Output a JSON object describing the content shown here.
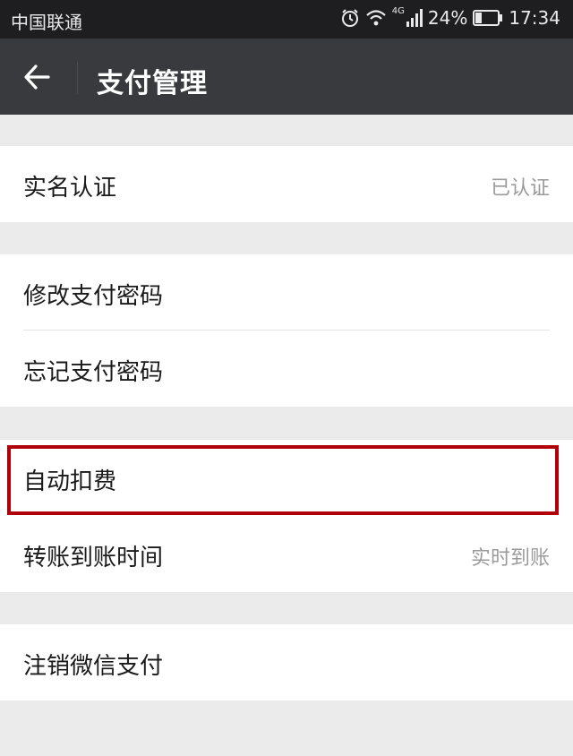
{
  "status_bar": {
    "carrier": "中国联通",
    "network": "4G",
    "battery": "24%",
    "time": "17:34",
    "icons": [
      "alarm-icon",
      "wifi-icon",
      "signal-icon",
      "battery-icon"
    ]
  },
  "header": {
    "title": "支付管理",
    "back_icon": "back-arrow-icon"
  },
  "groups": [
    {
      "rows": [
        {
          "label": "实名认证",
          "value": "已认证"
        }
      ]
    },
    {
      "rows": [
        {
          "label": "修改支付密码",
          "value": ""
        },
        {
          "label": "忘记支付密码",
          "value": ""
        }
      ]
    },
    {
      "rows": [
        {
          "label": "自动扣费",
          "value": ""
        },
        {
          "label": "转账到账时间",
          "value": "实时到账"
        }
      ]
    },
    {
      "rows": [
        {
          "label": "注销微信支付",
          "value": ""
        }
      ]
    }
  ],
  "colors": {
    "status_bar_bg": "#1e1e20",
    "title_bar_bg": "#383a3d",
    "page_bg": "#ebebeb",
    "highlight": "#b0000a"
  }
}
